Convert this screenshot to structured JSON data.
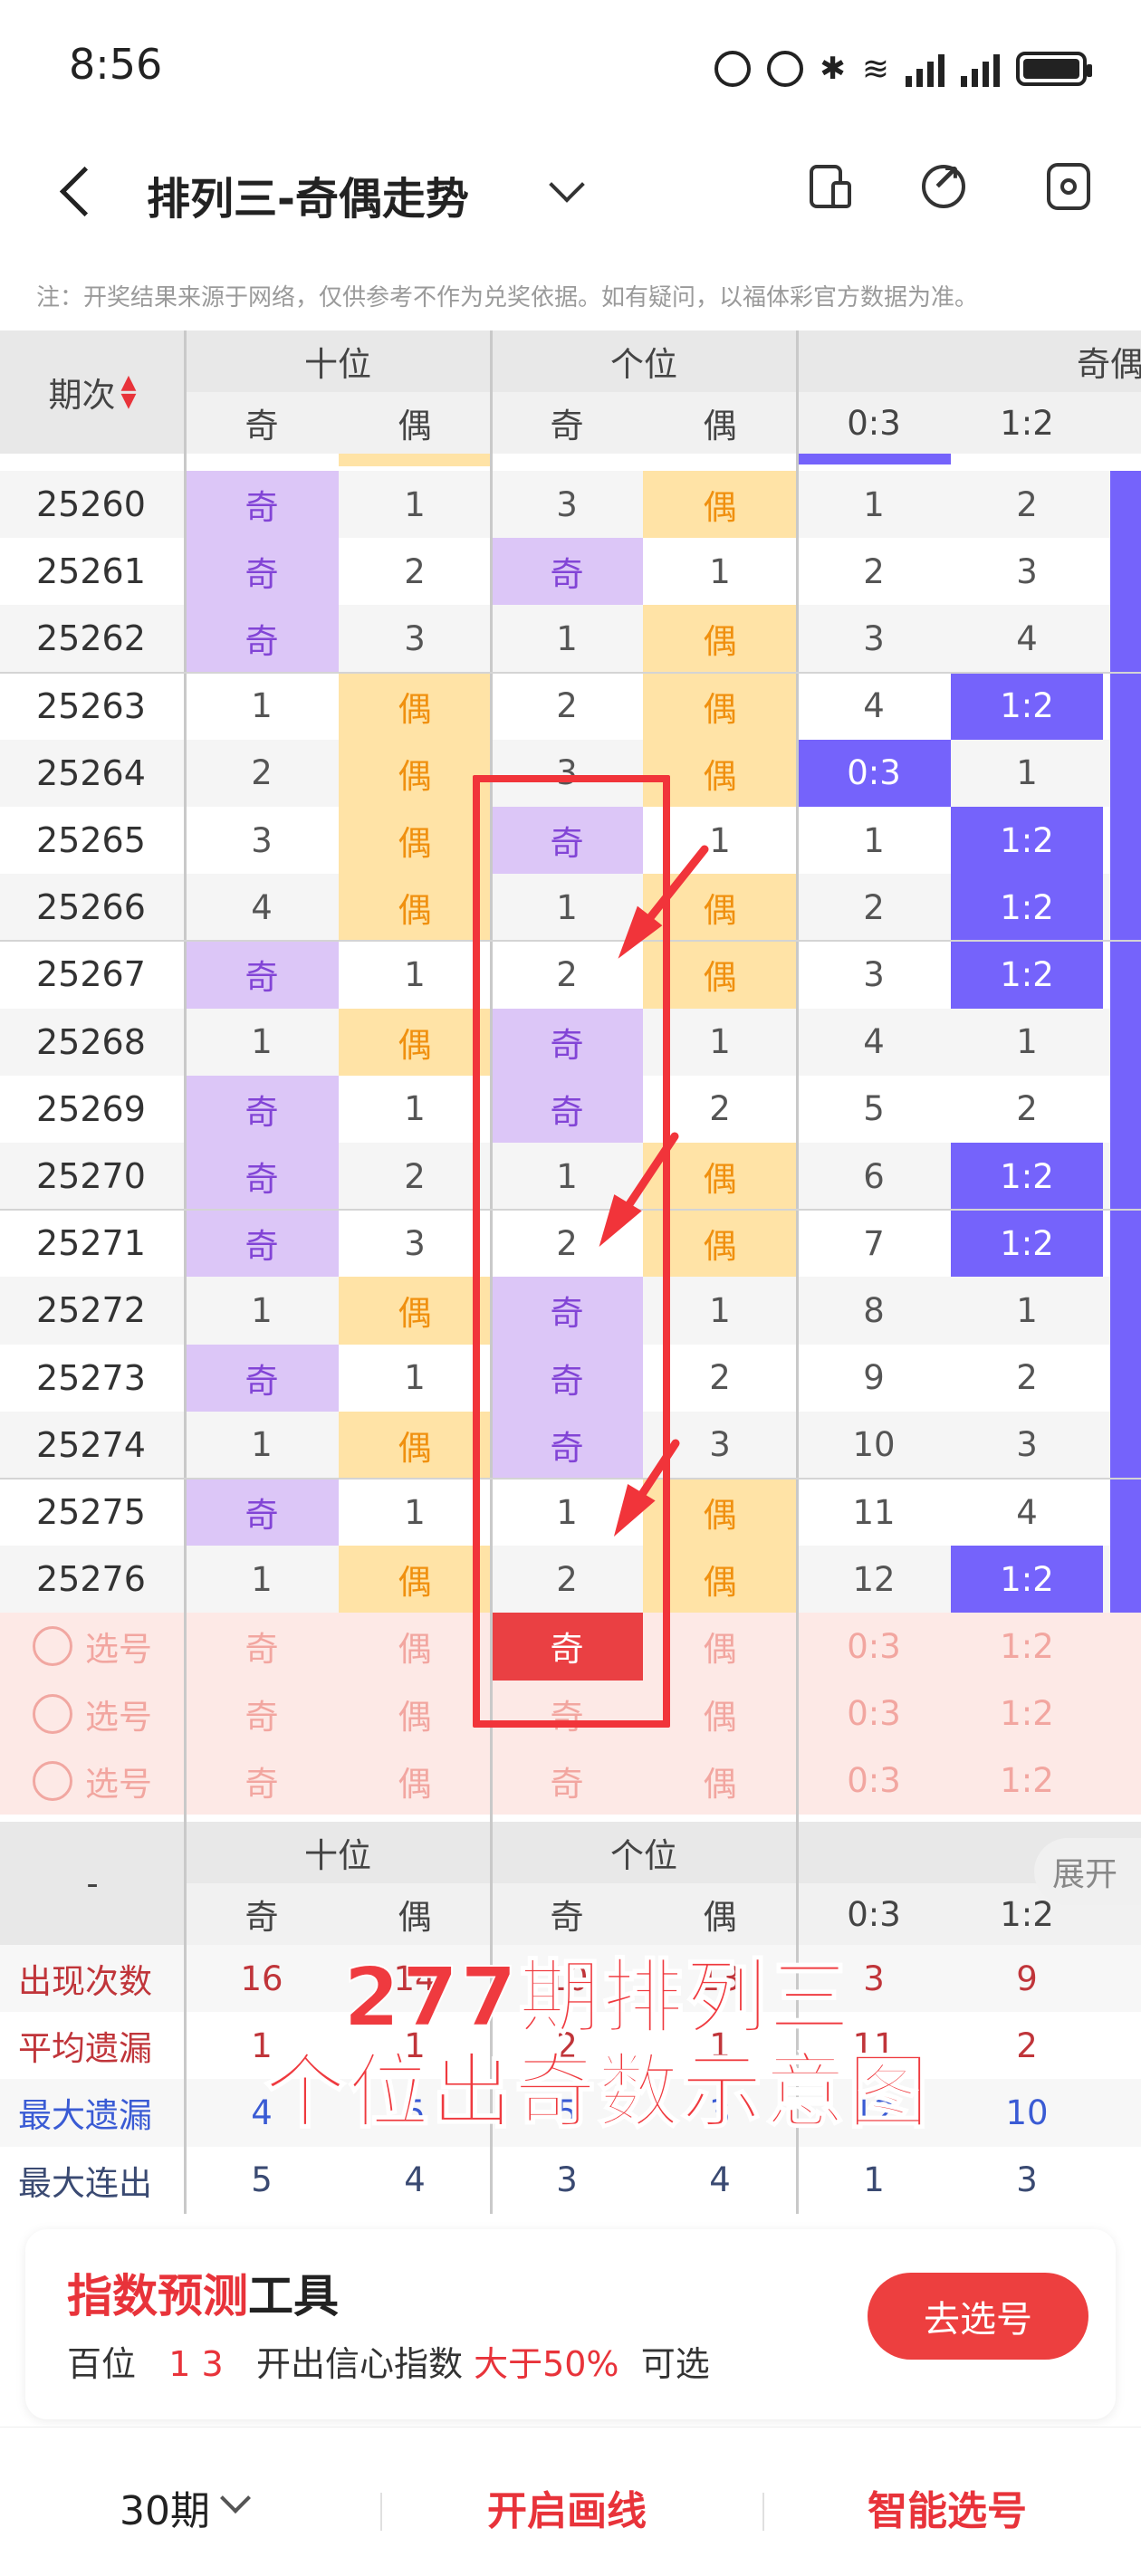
{
  "status": {
    "time": "8:56"
  },
  "header": {
    "title": "排列三-奇偶走势"
  },
  "notice": "注：开奖结果来源于网络，仅供参考不作为兑奖依据。如有疑问，以福体彩官方数据为准。",
  "table": {
    "col_period": "期次",
    "group_tens": "十位",
    "group_units": "个位",
    "group_ratio": "奇偶比",
    "sub_odd": "奇",
    "sub_even": "偶",
    "ratio_03": "0:3",
    "ratio_12": "1:2",
    "rows": [
      {
        "p": "25260",
        "t": "奇",
        "t2": "1",
        "u": "3",
        "u2": "偶",
        "r1": "1",
        "r2": "2"
      },
      {
        "p": "25261",
        "t": "奇",
        "t2": "2",
        "u": "奇",
        "u2": "1",
        "r1": "2",
        "r2": "3"
      },
      {
        "p": "25262",
        "t": "奇",
        "t2": "3",
        "u": "1",
        "u2": "偶",
        "r1": "3",
        "r2": "4"
      },
      {
        "p": "25263",
        "t": "1",
        "t2": "偶",
        "u": "2",
        "u2": "偶",
        "r1": "4",
        "r2": "1:2"
      },
      {
        "p": "25264",
        "t": "2",
        "t2": "偶",
        "u": "3",
        "u2": "偶",
        "r1": "0:3",
        "r2": "1"
      },
      {
        "p": "25265",
        "t": "3",
        "t2": "偶",
        "u": "奇",
        "u2": "1",
        "r1": "1",
        "r2": "1:2"
      },
      {
        "p": "25266",
        "t": "4",
        "t2": "偶",
        "u": "1",
        "u2": "偶",
        "r1": "2",
        "r2": "1:2"
      },
      {
        "p": "25267",
        "t": "奇",
        "t2": "1",
        "u": "2",
        "u2": "偶",
        "r1": "3",
        "r2": "1:2"
      },
      {
        "p": "25268",
        "t": "1",
        "t2": "偶",
        "u": "奇",
        "u2": "1",
        "r1": "4",
        "r2": "1"
      },
      {
        "p": "25269",
        "t": "奇",
        "t2": "1",
        "u": "奇",
        "u2": "2",
        "r1": "5",
        "r2": "2"
      },
      {
        "p": "25270",
        "t": "奇",
        "t2": "2",
        "u": "1",
        "u2": "偶",
        "r1": "6",
        "r2": "1:2"
      },
      {
        "p": "25271",
        "t": "奇",
        "t2": "3",
        "u": "2",
        "u2": "偶",
        "r1": "7",
        "r2": "1:2"
      },
      {
        "p": "25272",
        "t": "1",
        "t2": "偶",
        "u": "奇",
        "u2": "1",
        "r1": "8",
        "r2": "1"
      },
      {
        "p": "25273",
        "t": "奇",
        "t2": "1",
        "u": "奇",
        "u2": "2",
        "r1": "9",
        "r2": "2"
      },
      {
        "p": "25274",
        "t": "1",
        "t2": "偶",
        "u": "奇",
        "u2": "3",
        "r1": "10",
        "r2": "3"
      },
      {
        "p": "25275",
        "t": "奇",
        "t2": "1",
        "u": "1",
        "u2": "偶",
        "r1": "11",
        "r2": "4"
      },
      {
        "p": "25276",
        "t": "1",
        "t2": "偶",
        "u": "2",
        "u2": "偶",
        "r1": "12",
        "r2": "1:2"
      }
    ],
    "select_label": "选号",
    "stats_header_dash": "-",
    "stats": [
      {
        "label": "出现次数",
        "vals": [
          "16",
          "14",
          "10",
          "13",
          "3",
          "9"
        ]
      },
      {
        "label": "平均遗漏",
        "vals": [
          "1",
          "1",
          "2",
          "1",
          "11",
          "2"
        ]
      },
      {
        "label": "最大遗漏",
        "vals": [
          "4",
          "5",
          "5",
          "3",
          "12",
          "10"
        ]
      },
      {
        "label": "最大连出",
        "vals": [
          "5",
          "4",
          "3",
          "4",
          "1",
          "3"
        ]
      }
    ]
  },
  "overlay_caption": [
    "277期排列三",
    "个位出奇数示意图"
  ],
  "expand_label": "展开",
  "tool": {
    "title_red": "指数预测",
    "title_black": "工具",
    "desc_a": "百位",
    "desc_nums": "1 3",
    "desc_b": "开出信心指数",
    "desc_red": "大于50%",
    "desc_c": "可选",
    "button": "去选号"
  },
  "bottom": {
    "periods": "30期",
    "draw": "开启画线",
    "smart": "智能选号"
  }
}
